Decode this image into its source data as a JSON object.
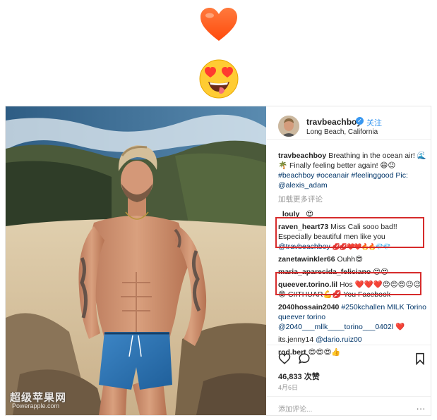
{
  "header": {
    "username": "travbeachboy",
    "follow_label": "关注",
    "location": "Long Beach, California"
  },
  "caption": {
    "username": "travbeachboy",
    "text": "Breathing in the ocean air! 🌊🌴 Finally feeling better again! 😄😉",
    "hashtags": "#beachboy #oceanair #feelinggood Pic:",
    "credit": "@alexis_adam"
  },
  "load_more_label": "加载更多评论",
  "comments": [
    {
      "username": "_louly_",
      "text": "😍"
    },
    {
      "username": "raven_heart73",
      "text": "Miss Cali sooo bad!! Especially beautiful men like you",
      "tag": "@travbeachboy",
      "emoji": "💋💋❤️❤️🔥🔥💎💎"
    },
    {
      "username": "zanetawinkler66",
      "text": "Ouhh😍"
    },
    {
      "username": "maria_aparecida_feliciano",
      "text": "😍😍"
    },
    {
      "username": "queever.torino.lil",
      "text": "Hos ❤️❤️❤️😍😍😍😉😉😍",
      "tail": "CIITHUAR💪💋 You Facebook"
    },
    {
      "username": "2040hossain2040",
      "text": "#250kchallen MILK Torino queever torino",
      "tag": "@2040___mllk____torino___0402l",
      "emoji": "❤️"
    },
    {
      "username": "its.jenny14",
      "tag": "@dario.ruiz00"
    },
    {
      "username": "rod.bert",
      "text": "😍😍😍👍"
    }
  ],
  "likes_text": "46,833 次赞",
  "date_text": "4月6日",
  "add_comment_placeholder": "添加评论...",
  "more_options": "...",
  "watermark": "超级苹果网",
  "watermark_sub": "Powerapple.com",
  "colors": {
    "link": "#003569",
    "follow": "#3897f0",
    "highlight": "#d62b2b",
    "muted": "#999999"
  },
  "icons": [
    "heart-emoji",
    "heart-eyes-face-emoji",
    "verified-badge-icon",
    "like-heart-icon",
    "comment-bubble-icon",
    "bookmark-icon"
  ]
}
